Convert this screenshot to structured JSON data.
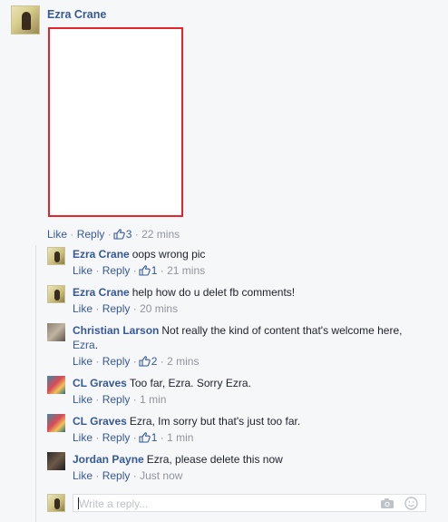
{
  "post": {
    "author": "Ezra Crane",
    "actions": {
      "like": "Like",
      "reply": "Reply",
      "like_count": "3",
      "time": "22 mins"
    }
  },
  "replies": [
    {
      "author": "Ezra Crane",
      "text": "oops wrong pic",
      "like": "Like",
      "reply": "Reply",
      "like_count": "1",
      "time": "21 mins"
    },
    {
      "author": "Ezra Crane",
      "text": "help how do u delet fb comments!",
      "like": "Like",
      "reply": "Reply",
      "time": "20 mins"
    },
    {
      "author": "Christian Larson",
      "text": "Not really the kind of content that's welcome here,",
      "mention": "Ezra",
      "mention_suffix": ".",
      "like": "Like",
      "reply": "Reply",
      "like_count": "2",
      "time": "2 mins"
    },
    {
      "author": "CL Graves",
      "text": "Too far, Ezra. Sorry Ezra.",
      "like": "Like",
      "reply": "Reply",
      "time": "1 min"
    },
    {
      "author": "CL Graves",
      "text": "Ezra, Im sorry but that's just too far.",
      "like": "Like",
      "reply": "Reply",
      "like_count": "1",
      "time": "1 min"
    },
    {
      "author": "Jordan Payne",
      "text": "Ezra, please delete this now",
      "like": "Like",
      "reply": "Reply",
      "time": "Just now"
    }
  ],
  "composer": {
    "placeholder": "Write a reply..."
  },
  "icons": [
    "thumbs-up-icon",
    "camera-icon",
    "emoji-icon"
  ],
  "colors": {
    "name_link": "#365899",
    "meta_gray": "#90949c",
    "photo_border": "#e4262c",
    "background": "#f6f7f9"
  }
}
